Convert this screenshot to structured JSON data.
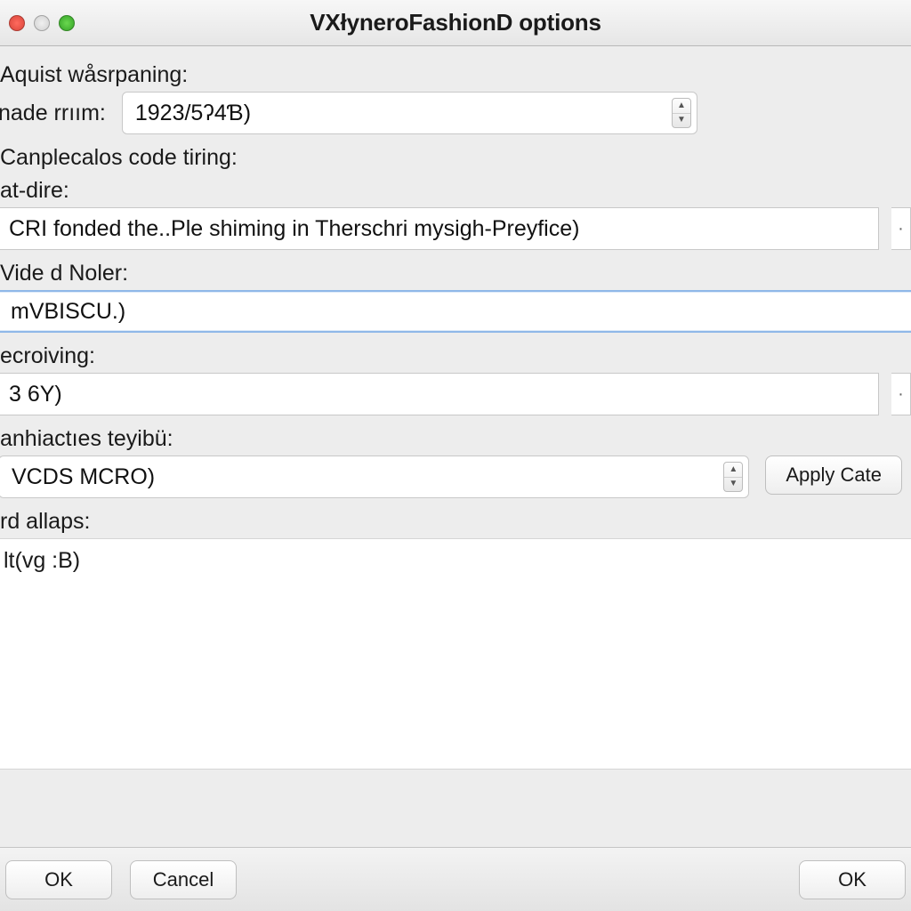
{
  "window": {
    "title": "VXłyneroFashionD options"
  },
  "form": {
    "aquist_label": "Aquist wåsrpaning:",
    "nade_label": "nade rrıım:",
    "nade_value": "1923/5ʔ4Ɓ)",
    "code_tiring_label": "Canplecalos code tiring:",
    "at_dire_label": "at-dire:",
    "at_dire_value": "CRI fonded the..Ple shiming in Therschri mysigh-Preyfice)",
    "vide_label": "Vide d Noler:",
    "vide_value": "mVBISCU.)",
    "ecroiving_label": "ecroiving:",
    "ecroiving_value": "3 6Y)",
    "teyibu_label": "anhiactıes teyibü:",
    "teyibu_value": "VCDS MCRO)",
    "apply_label": "Apply Cate",
    "rd_allaps_label": "rd allaps:",
    "textarea_value": "lt(vg :B)"
  },
  "footer": {
    "ok": "OK",
    "cancel": "Cancel",
    "ok_right": "OK"
  }
}
